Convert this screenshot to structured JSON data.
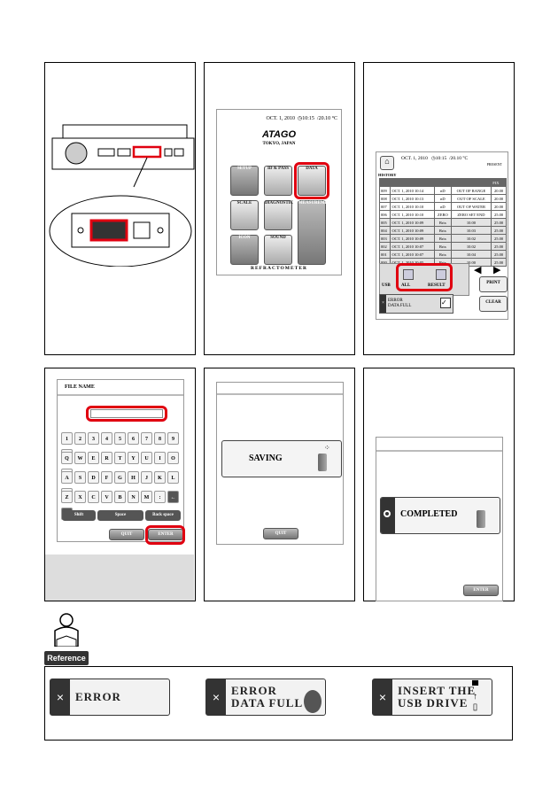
{
  "home": {
    "date": "OCT. 1, 2010",
    "time": "10:15",
    "temp": "20.10 °C",
    "brand": "ATAGO",
    "location": "TOKYO, JAPAN",
    "footer": "REFRACTOMETER",
    "buttons": [
      "SETUP",
      "ID & PASS",
      "DATA",
      "SCALE",
      "DIAGNOSTIC",
      "MEASUREMENT",
      "ICON",
      "SOUND"
    ]
  },
  "history": {
    "date": "OCT. 1, 2010",
    "time": "10:15",
    "temp": "20.10 °C",
    "present": "PRESENT",
    "title": "HISTORY",
    "fix": "FIX",
    "rows": [
      [
        "009",
        "OCT. 1, 2010 10:14",
        "nD",
        "OUT OF RANGE",
        "20.00"
      ],
      [
        "008",
        "OCT. 1, 2010 10:13",
        "nD",
        "OUT OF SCALE",
        "20.00"
      ],
      [
        "007",
        "OCT. 1, 2010 10:10",
        "nD",
        "OUT OF WATER",
        "20.00"
      ],
      [
        "006",
        "OCT. 1, 2010 10:10",
        "ZERO",
        "ZERO SET END",
        "25.00"
      ],
      [
        "005",
        "OCT. 1, 2010 10:09",
        "Brix",
        "10.00",
        "25.00"
      ],
      [
        "004",
        "OCT. 1, 2010 10:09",
        "Brix",
        "10.03",
        "25.00"
      ],
      [
        "003",
        "OCT. 1, 2010 10:09",
        "Brix",
        "10.02",
        "25.00"
      ],
      [
        "002",
        "OCT. 1, 2010 10:07",
        "Brix",
        "10.02",
        "25.00"
      ],
      [
        "001",
        "OCT. 1, 2010 10:07",
        "Brix",
        "10.04",
        "25.00"
      ],
      [
        "000",
        "OCT. 1, 2010 10:05",
        "Brix",
        "10.00",
        "25.00"
      ]
    ],
    "usb": "USB",
    "all": "ALL",
    "result": "RESULT",
    "print": "PRINT",
    "clear": "CLEAR",
    "error1": "ERROR",
    "error2": "DATA FULL"
  },
  "keyboard": {
    "title": "FILE NAME",
    "input_value": "",
    "row1": [
      "1",
      "2",
      "3",
      "4",
      "5",
      "6",
      "7",
      "8",
      "9",
      "0"
    ],
    "row2": [
      "Q",
      "W",
      "E",
      "R",
      "T",
      "Y",
      "U",
      "I",
      "O",
      "P"
    ],
    "row3": [
      "A",
      "S",
      "D",
      "F",
      "G",
      "H",
      "J",
      "K",
      "L",
      ";"
    ],
    "row4": [
      "Z",
      "X",
      "C",
      "V",
      "B",
      "N",
      "M",
      ":",
      "←",
      "→"
    ],
    "shift": "Shift",
    "space": "Space",
    "backspace": "Back space",
    "quit": "QUIT",
    "enter": "ENTER"
  },
  "saving": {
    "label": "SAVING",
    "quit": "QUIT"
  },
  "completed": {
    "label": "COMPLETED",
    "enter": "ENTER"
  },
  "reference": {
    "label": "Reference"
  },
  "messages": [
    {
      "line1": "ERROR",
      "line2": ""
    },
    {
      "line1": "ERROR",
      "line2": "DATA FULL"
    },
    {
      "line1": "INSERT THE",
      "line2": "USB DRIVE"
    }
  ]
}
